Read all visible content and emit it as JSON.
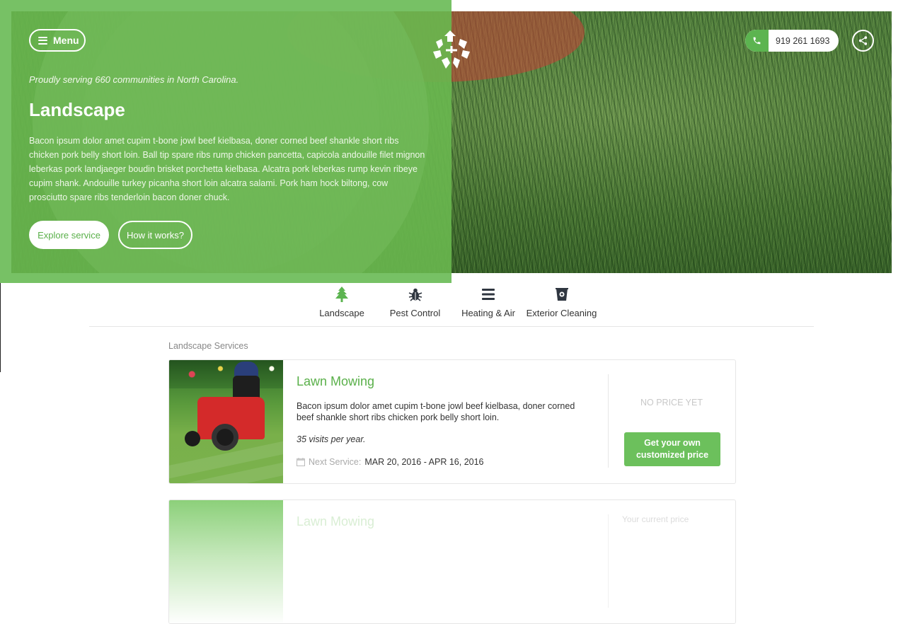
{
  "header": {
    "menu_label": "Menu",
    "phone": "919 261 1693"
  },
  "hero": {
    "tagline": "Proudly serving 660 communities in North Carolina.",
    "title": "Landscape",
    "description": "Bacon ipsum dolor amet cupim t-bone jowl beef kielbasa, doner corned beef shankle short ribs chicken pork belly short loin. Ball tip spare ribs rump chicken pancetta, capicola andouille filet mignon leberkas pork landjaeger boudin brisket porchetta kielbasa. Alcatra pork leberkas rump kevin ribeye cupim shank. Andouille turkey picanha short loin alcatra salami. Pork ham hock biltong, cow prosciutto spare ribs tenderloin bacon doner chuck.",
    "explore_label": "Explore service",
    "how_label": "How it works?",
    "accent_color": "#5ab04a"
  },
  "categories": [
    {
      "label": "Landscape",
      "icon": "tree-icon"
    },
    {
      "label": "Pest Control",
      "icon": "bug-icon"
    },
    {
      "label": "Heating & Air",
      "icon": "hvac-icon"
    },
    {
      "label": "Exterior Cleaning",
      "icon": "bucket-icon"
    }
  ],
  "services": {
    "section_label": "Landscape Services",
    "items": [
      {
        "title": "Lawn Mowing",
        "description": "Bacon ipsum dolor amet cupim t-bone jowl beef kielbasa, doner corned beef shankle short ribs chicken pork belly short loin.",
        "visits": "35 visits per year.",
        "next_label": "Next Service:",
        "next_value": "MAR 20, 2016 - APR 16, 2016",
        "price_status": "NO PRICE YET",
        "price_button": "Get your own customized price"
      },
      {
        "title": "Lawn Mowing",
        "price_status": "Your current price"
      }
    ]
  }
}
